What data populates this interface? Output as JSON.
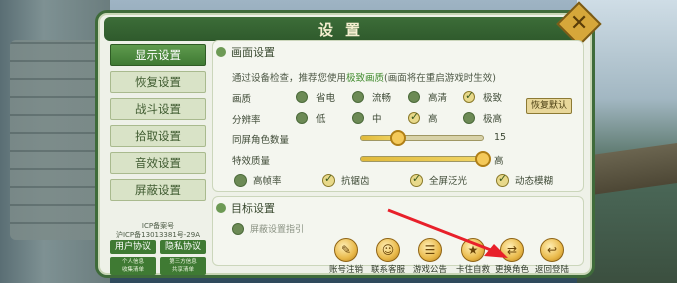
{
  "window": {
    "title": "设置"
  },
  "nav": {
    "items": [
      {
        "label": "显示设置",
        "active": true
      },
      {
        "label": "恢复设置",
        "active": false
      },
      {
        "label": "战斗设置",
        "active": false
      },
      {
        "label": "拾取设置",
        "active": false
      },
      {
        "label": "音效设置",
        "active": false
      },
      {
        "label": "屏蔽设置",
        "active": false
      }
    ]
  },
  "icp": {
    "line1": "ICP备案号",
    "line2": "沪ICP备13013381号-29A"
  },
  "footer_links": {
    "user_agreement": "用户协议",
    "privacy_agreement": "隐私协议",
    "personal_info_line1": "个人信息",
    "personal_info_line2": "收集清单",
    "third_party_line1": "第三方信息",
    "third_party_line2": "共享清单"
  },
  "display": {
    "section_title": "画面设置",
    "hint_prefix": "通过设备检查，推荐您使用",
    "hint_highlight": "极致画质",
    "hint_suffix": "(画面将在重启游戏时生效)",
    "quality": {
      "label": "画质",
      "options": [
        "省电",
        "流畅",
        "高清",
        "极致"
      ],
      "selected": "极致"
    },
    "resolution": {
      "label": "分辨率",
      "options": [
        "低",
        "中",
        "高",
        "极高"
      ],
      "selected": "高"
    },
    "reset_label": "恢复默认",
    "same_screen": {
      "label": "同屏角色数量",
      "value": "15",
      "fraction": 0.3
    },
    "effect_quality": {
      "label": "特效质量",
      "value": "高",
      "fraction": 1.0
    },
    "toggles": [
      {
        "label": "高帧率",
        "checked": false
      },
      {
        "label": "抗锯齿",
        "checked": true
      },
      {
        "label": "全屏泛光",
        "checked": true
      },
      {
        "label": "动态模糊",
        "checked": true
      }
    ]
  },
  "target": {
    "section_title": "目标设置",
    "sub_label": "屏蔽设置指引"
  },
  "actions": [
    {
      "label": "账号注销",
      "icon": "account-cancel-icon"
    },
    {
      "label": "联系客服",
      "icon": "customer-service-icon"
    },
    {
      "label": "游戏公告",
      "icon": "announcement-icon"
    },
    {
      "label": "卡住自救",
      "icon": "rescue-icon"
    },
    {
      "label": "更换角色",
      "icon": "switch-character-icon"
    },
    {
      "label": "返回登陆",
      "icon": "return-login-icon"
    }
  ],
  "colors": {
    "accent_green": "#3f7a33",
    "title_bar": "#2f5a2c",
    "highlight": "#3f8a2c",
    "slider": "#e0b93a",
    "annotation_arrow": "#e8202a"
  }
}
